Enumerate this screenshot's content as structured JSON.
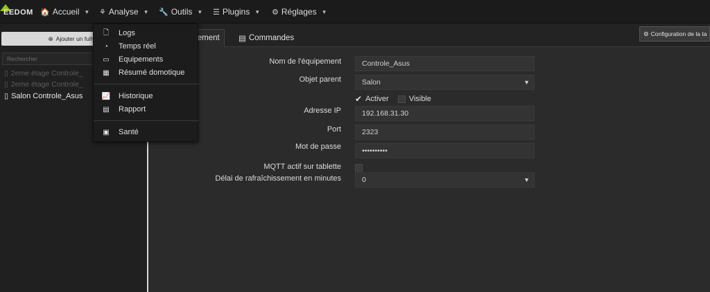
{
  "navbar": {
    "logo_text": "EEDOM",
    "items": [
      {
        "label": "Accueil",
        "icon": "home-icon",
        "glyph": "🏠"
      },
      {
        "label": "Analyse",
        "icon": "analyse-icon",
        "glyph": "⚘"
      },
      {
        "label": "Outils",
        "icon": "wrench-icon",
        "glyph": "🔧"
      },
      {
        "label": "Plugins",
        "icon": "list-icon",
        "glyph": "☰"
      },
      {
        "label": "Réglages",
        "icon": "gears-icon",
        "glyph": "⚙"
      }
    ]
  },
  "analyse_menu": {
    "items": [
      {
        "label": "Logs",
        "icon": "file-icon",
        "glyph": "🗋"
      },
      {
        "label": "Temps réel",
        "icon": "gauge-icon",
        "glyph": "◔"
      },
      {
        "label": "Equipements",
        "icon": "battery-icon",
        "glyph": "▭"
      },
      {
        "label": "Résumé domotique",
        "icon": "grid-icon",
        "glyph": "▦"
      },
      {
        "label": "Historique",
        "icon": "chart-icon",
        "glyph": "📈"
      },
      {
        "label": "Rapport",
        "icon": "newspaper-icon",
        "glyph": "▤"
      },
      {
        "label": "Santé",
        "icon": "medkit-icon",
        "glyph": "▣"
      }
    ]
  },
  "left_panel": {
    "add_button_label": "Ajouter un fullyKi",
    "search_placeholder": "Rechercher",
    "equipments": [
      {
        "label": "2eme étage Controle_",
        "state": "disabled"
      },
      {
        "label": "2eme étage Controle_",
        "state": "disabled"
      },
      {
        "label": "Salon Controle_Asus",
        "state": "active"
      }
    ]
  },
  "tabs": [
    {
      "label": "quipement",
      "icon": "tachometer-icon"
    },
    {
      "label": "Commandes",
      "icon": "list-alt-icon"
    }
  ],
  "config_button_label": "Configuration de la ta",
  "form": {
    "nom_label": "Nom de l'équipement",
    "nom_value": "Controle_Asus",
    "objet_label": "Objet parent",
    "objet_value": "Salon",
    "activer_label": "Activer",
    "visible_label": "Visible",
    "ip_label": "Adresse IP",
    "ip_value": "192.168.31.30",
    "port_label": "Port",
    "port_value": "2323",
    "password_label": "Mot de passe",
    "password_value": "••••••••••",
    "mqtt_label": "MQTT actif sur tablette",
    "delai_label": "Délai de rafraîchissement en minutes",
    "delai_value": "0"
  }
}
